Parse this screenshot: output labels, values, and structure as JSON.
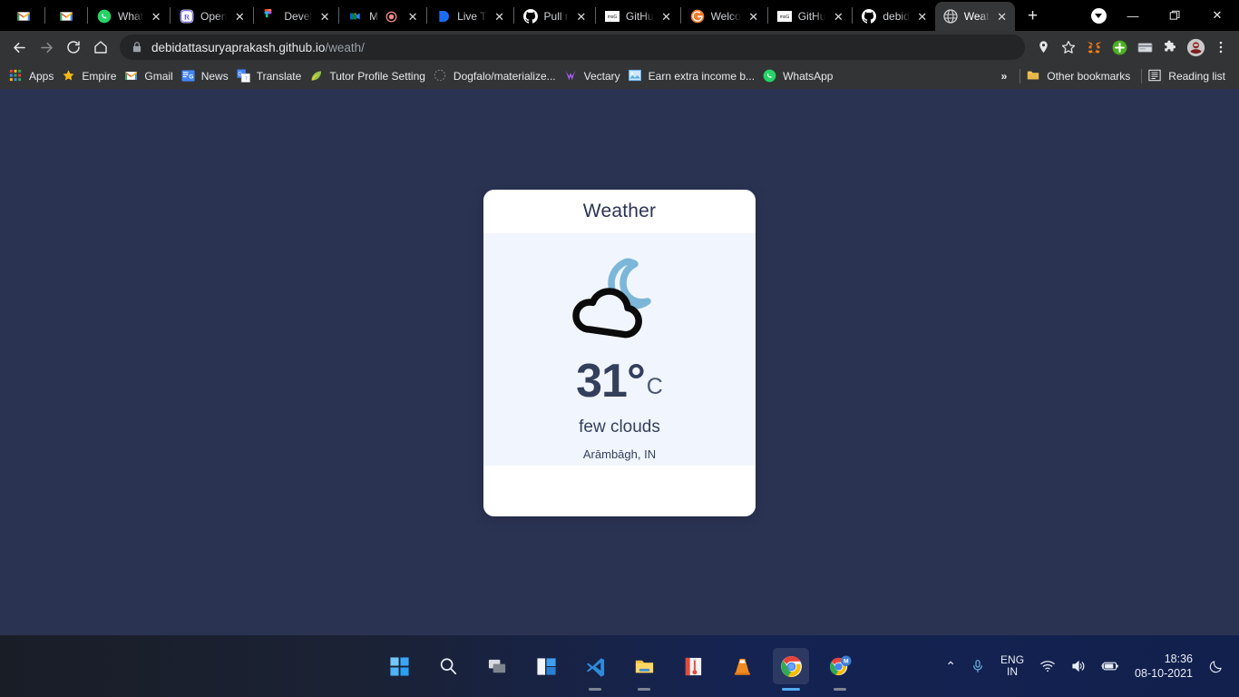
{
  "browser": {
    "tabs": [
      {
        "label": "",
        "icon": "gmail-icon",
        "pinned": true,
        "active": false
      },
      {
        "label": "",
        "icon": "gmail-icon",
        "pinned": true,
        "active": false
      },
      {
        "label": "What",
        "icon": "whatsapp-icon",
        "pinned": false,
        "active": false
      },
      {
        "label": "Open",
        "icon": "r-app-icon",
        "pinned": false,
        "active": false
      },
      {
        "label": "Devel",
        "icon": "figma-icon",
        "pinned": false,
        "active": false
      },
      {
        "label": "M",
        "icon": "google-meet-recording-icon",
        "pinned": false,
        "active": false
      },
      {
        "label": "Live T",
        "icon": "blue-app-icon",
        "pinned": false,
        "active": false
      },
      {
        "label": "Pull r",
        "icon": "github-icon",
        "pinned": false,
        "active": false
      },
      {
        "label": "GitHu",
        "icon": "msg-page-icon",
        "pinned": false,
        "active": false
      },
      {
        "label": "Welco",
        "icon": "orange-g-icon",
        "pinned": false,
        "active": false
      },
      {
        "label": "GitHu",
        "icon": "msg-page-icon",
        "pinned": false,
        "active": false
      },
      {
        "label": "debid",
        "icon": "github-icon",
        "pinned": false,
        "active": false
      },
      {
        "label": "Weat",
        "icon": "globe-icon",
        "pinned": false,
        "active": true
      }
    ],
    "tab_close_glyph": "✕",
    "new_tab_glyph": "+",
    "window_controls": {
      "minimize": "—",
      "maximize": "❐",
      "close": "✕"
    },
    "url": {
      "domain": "debidattasuryaprakash.github.io",
      "path": "/weath/"
    },
    "nav": {
      "back": "←",
      "forward": "→",
      "reload": "↻",
      "home": "⌂"
    },
    "toolbar_icons": [
      "location-pin-icon",
      "bookmark-star-icon",
      "metamask-icon",
      "green-plus-icon",
      "card-icon",
      "extensions-puzzle-icon",
      "profile-avatar",
      "chrome-menu-icon"
    ],
    "bookmarks": [
      {
        "label": "Apps",
        "icon": "apps-grid-icon"
      },
      {
        "label": "Empire",
        "icon": "star-icon"
      },
      {
        "label": "Gmail",
        "icon": "gmail-icon"
      },
      {
        "label": "News",
        "icon": "google-news-icon"
      },
      {
        "label": "Translate",
        "icon": "google-translate-icon"
      },
      {
        "label": "Tutor Profile Setting",
        "icon": "leaf-icon"
      },
      {
        "label": "Dogfalo/materialize...",
        "icon": "dotted-icon"
      },
      {
        "label": "Vectary",
        "icon": "vectary-icon"
      },
      {
        "label": "Earn extra income b...",
        "icon": "image-icon"
      },
      {
        "label": "WhatsApp",
        "icon": "whatsapp-icon"
      }
    ],
    "bookmarks_overflow": "»",
    "other_bookmarks": {
      "label": "Other bookmarks",
      "icon": "folder-icon"
    },
    "reading_list": {
      "label": "Reading list",
      "icon": "reading-list-icon"
    }
  },
  "page": {
    "background_color": "#2b3353",
    "card": {
      "title": "Weather",
      "weather_icon": "moon-cloud-icon",
      "temperature": "31°",
      "unit": "C",
      "description": "few clouds",
      "location": "Arāmbāgh, IN",
      "moon_color": "#7cb6d8",
      "cloud_color": "#0b0b0b",
      "body_color": "#f1f6fe",
      "text_color": "#343f5c"
    }
  },
  "taskbar": {
    "items": [
      {
        "name": "start-button",
        "icon": "windows-logo-icon",
        "running": false,
        "active": false
      },
      {
        "name": "search-button",
        "icon": "search-icon",
        "running": false,
        "active": false
      },
      {
        "name": "task-view-button",
        "icon": "task-view-icon",
        "running": false,
        "active": false
      },
      {
        "name": "widgets-button",
        "icon": "widgets-icon",
        "running": false,
        "active": false
      },
      {
        "name": "vscode-button",
        "icon": "vscode-icon",
        "running": true,
        "active": false
      },
      {
        "name": "file-explorer-button",
        "icon": "file-explorer-icon",
        "running": true,
        "active": false
      },
      {
        "name": "thermometer-app-button",
        "icon": "thermometer-app-icon",
        "running": false,
        "active": false
      },
      {
        "name": "vlc-button",
        "icon": "vlc-cone-icon",
        "running": false,
        "active": false
      },
      {
        "name": "chrome-button",
        "icon": "chrome-icon",
        "running": true,
        "active": true
      },
      {
        "name": "chrome-m-button",
        "icon": "chrome-m-icon",
        "running": true,
        "active": false
      }
    ],
    "tray": {
      "overflow_glyph": "⌃",
      "microphone": "microphone-icon",
      "language_primary": "ENG",
      "language_secondary": "IN",
      "wifi": "wifi-icon",
      "volume": "volume-icon",
      "battery": "battery-charging-icon",
      "time": "18:36",
      "date": "08-10-2021",
      "notifications": "moon-dnd-icon"
    }
  }
}
